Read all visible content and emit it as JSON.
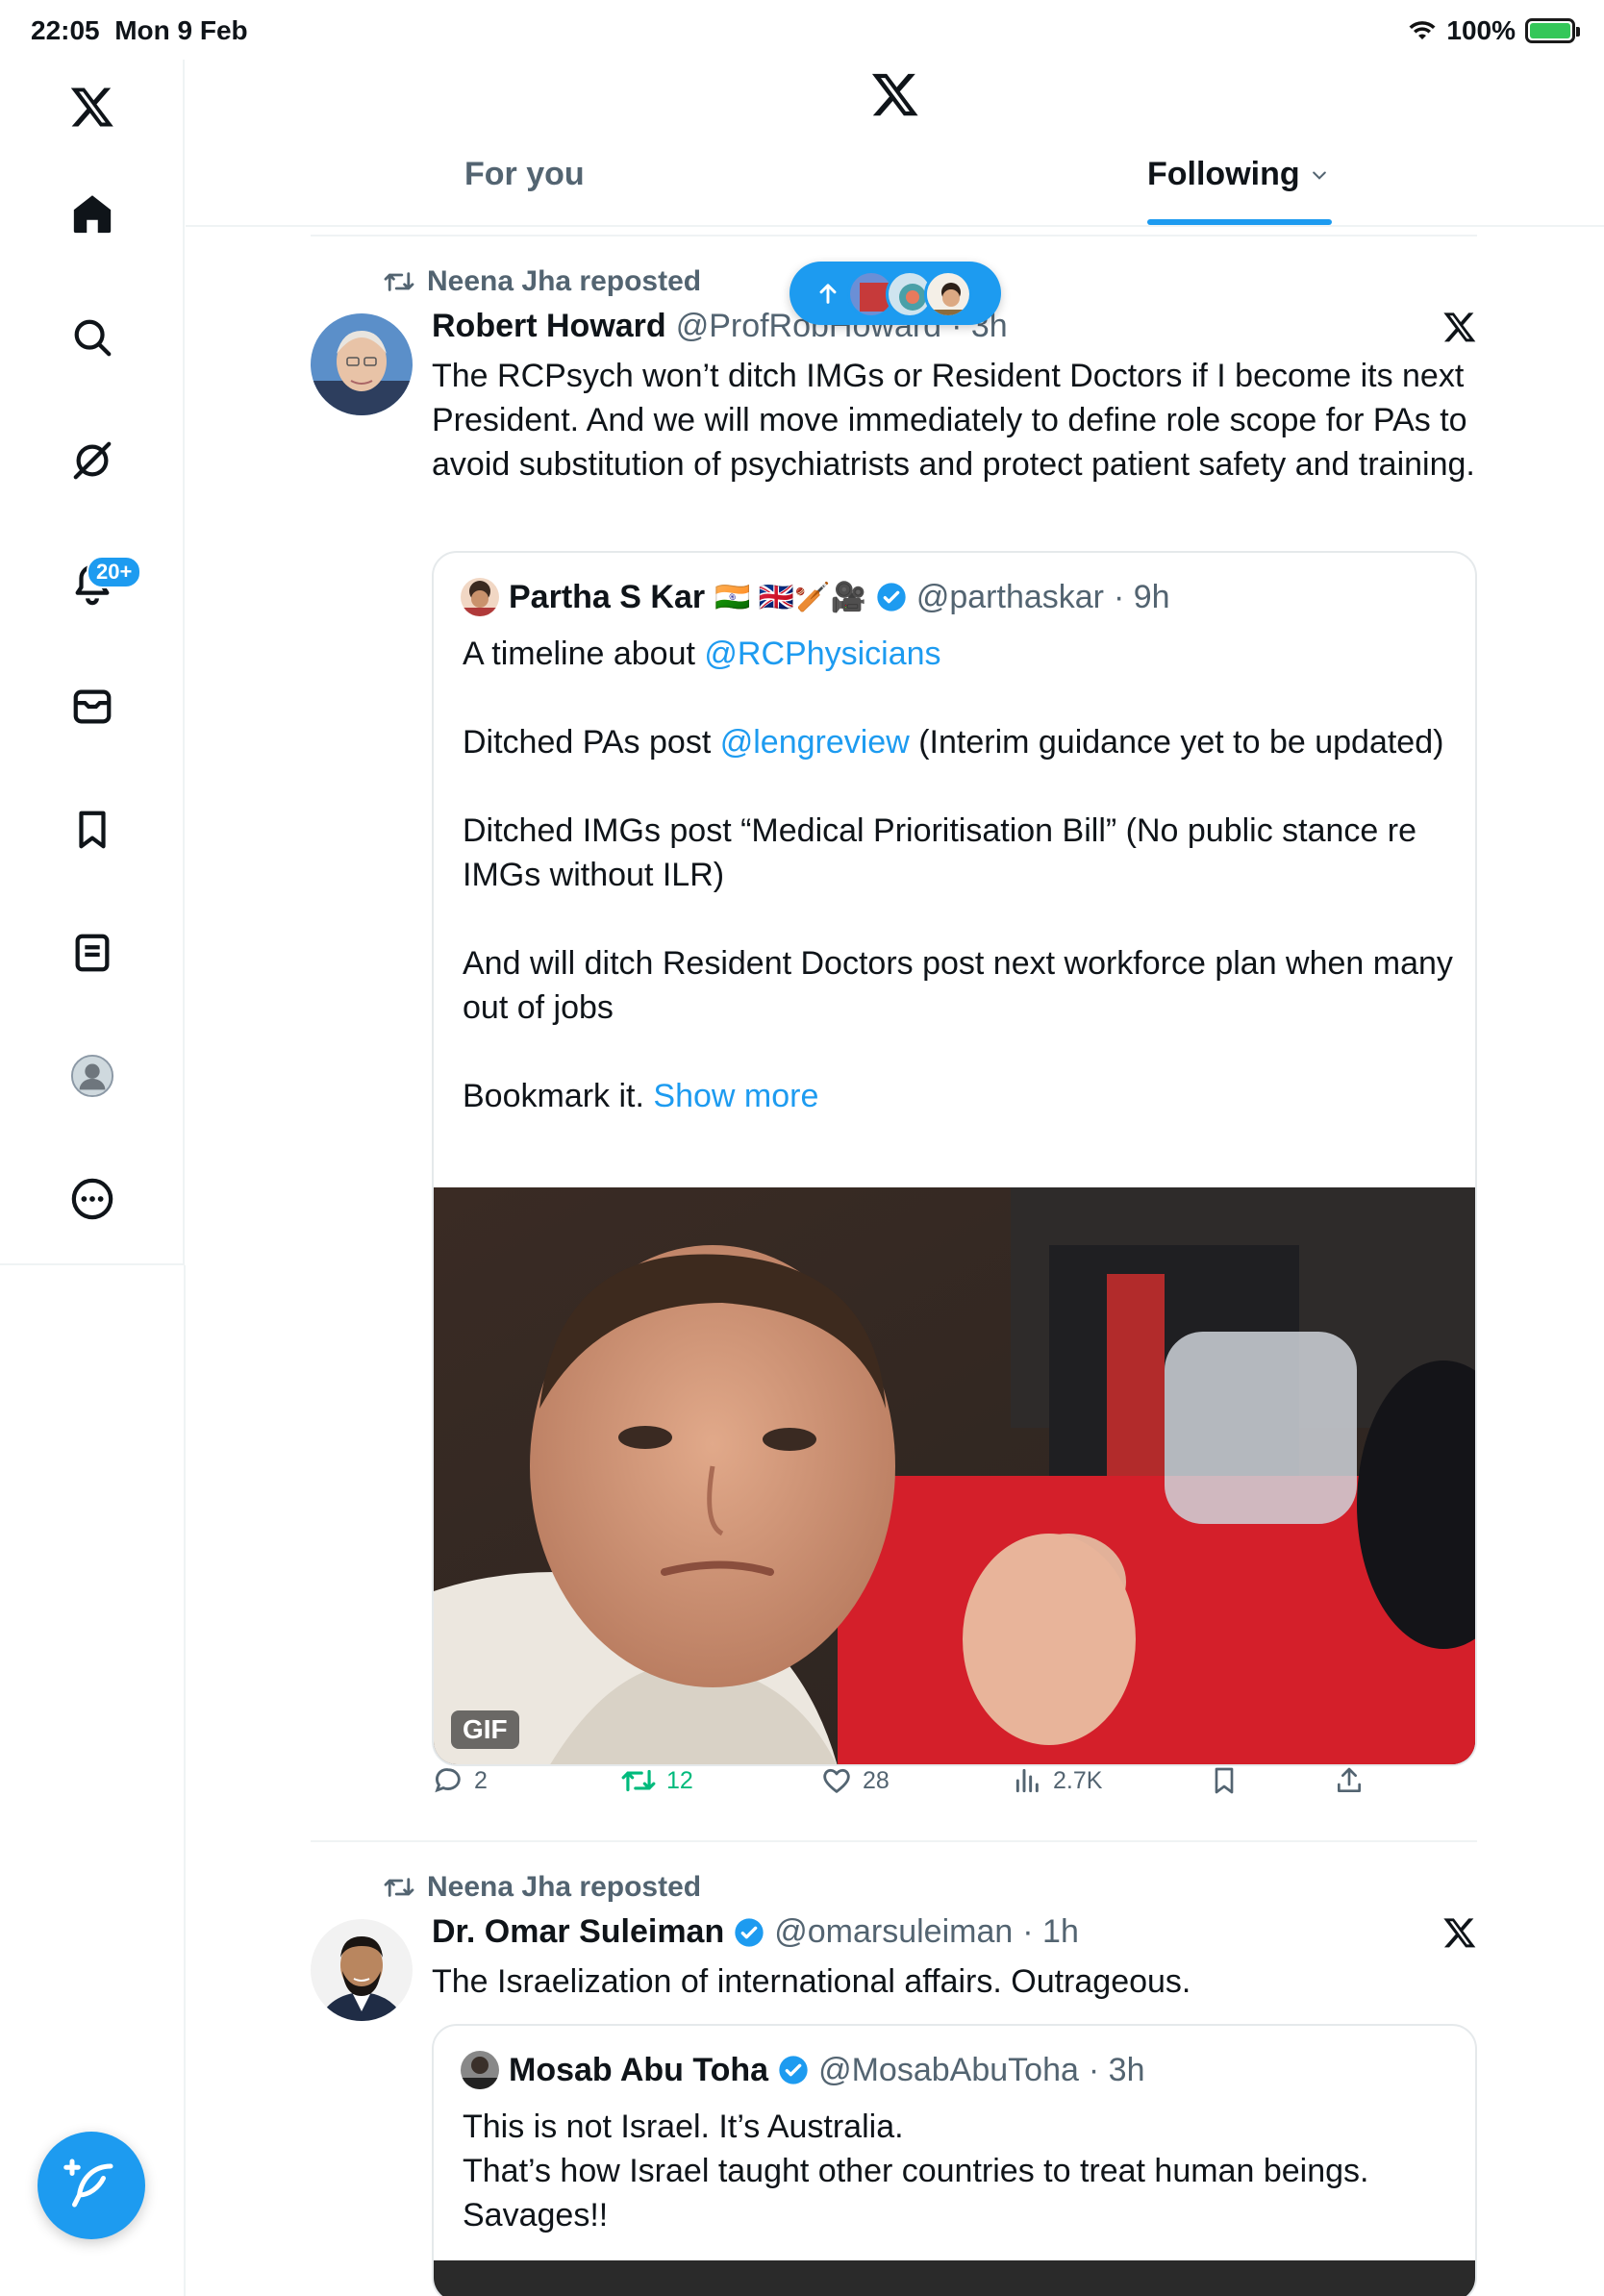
{
  "status_bar": {
    "time": "22:05",
    "date": "Mon 9 Feb",
    "battery": "100%"
  },
  "sidebar": {
    "items": [
      {
        "icon": "x-logo-icon"
      },
      {
        "icon": "home-icon"
      },
      {
        "icon": "search-icon"
      },
      {
        "icon": "grok-icon"
      },
      {
        "icon": "bell-icon",
        "badge": "20+"
      },
      {
        "icon": "mail-icon"
      },
      {
        "icon": "bookmark-icon"
      },
      {
        "icon": "list-icon"
      },
      {
        "icon": "profile-icon"
      },
      {
        "icon": "more-icon"
      }
    ],
    "compose_icon": "compose-icon"
  },
  "header": {
    "tabs": [
      {
        "label": "For you",
        "active": false
      },
      {
        "label": "Following",
        "active": true
      }
    ]
  },
  "new_posts_pill": {
    "icon": "arrow-up-icon",
    "avatars": 3
  },
  "posts": [
    {
      "repost_text": "Neena Jha reposted",
      "author_name": "Robert Howard",
      "author_handle": "@ProfRobHoward",
      "time": "· 3h",
      "text": "The RCPsych won’t ditch IMGs or Resident Doctors if I become its next President. And we will move immediately to define role scope for PAs to avoid substitution of psychiatrists and protect patient safety and training.",
      "quote": {
        "name": "Partha S Kar",
        "flags": "🇮🇳 🇬🇧🏏🎥",
        "verified": true,
        "handle": "@parthaskar",
        "time": "· 9h",
        "p1_text": "A timeline about ",
        "p1_link": "@RCPhysicians",
        "p2_text": "Ditched PAs post ",
        "p2_link": "@lengreview",
        "p2_rest": " (Interim guidance yet to be updated)",
        "p3": "Ditched IMGs post “Medical Prioritisation Bill” (No public stance re IMGs without ILR)",
        "p4": "And will ditch Resident Doctors post next workforce plan when many out of jobs",
        "p5_text": "Bookmark it. ",
        "p5_link": "Show more",
        "gif_label": "GIF"
      },
      "actions": {
        "replies": "2",
        "reposts": "12",
        "likes": "28",
        "views": "2.7K"
      }
    },
    {
      "repost_text": "Neena Jha reposted",
      "author_name": "Dr. Omar Suleiman",
      "author_verified": true,
      "author_handle": "@omarsuleiman",
      "time": "· 1h",
      "text": "The Israelization of international affairs. Outrageous.",
      "quote": {
        "name": "Mosab Abu Toha",
        "verified": true,
        "handle": "@MosabAbuToha",
        "time": "· 3h",
        "line1": "This is not Israel. It’s Australia.",
        "line2": "That’s how Israel taught other countries to treat human beings.",
        "line3": "Savages!!"
      }
    }
  ]
}
